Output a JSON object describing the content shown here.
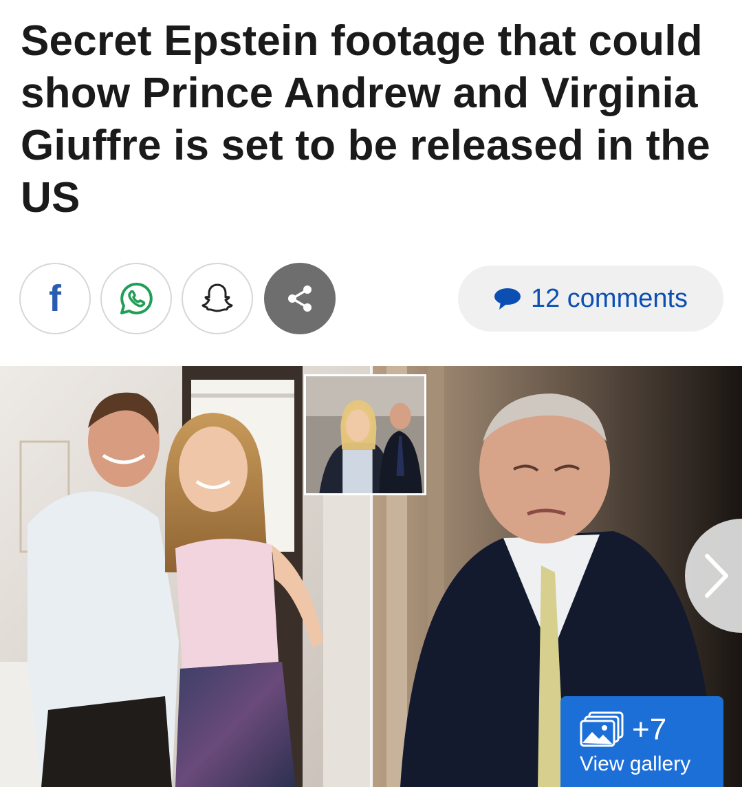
{
  "article": {
    "headline": "Secret Epstein footage that could show Prince Andrew and Virginia Giuffre is set to be released in the US"
  },
  "share": {
    "facebook_icon": "facebook-icon",
    "whatsapp_icon": "whatsapp-icon",
    "snapchat_icon": "snapchat-icon",
    "more_icon": "share-icon",
    "facebook_letter": "f"
  },
  "comments": {
    "label": "12 comments",
    "icon": "speech-bubble-icon"
  },
  "gallery": {
    "count": "+7",
    "label": "View gallery",
    "icon": "gallery-icon"
  },
  "colors": {
    "headline": "#1a1a1a",
    "comments_text": "#0b4fb3",
    "gallery_badge": "#1d6fd8",
    "share_more_bg": "#6e6e6e"
  }
}
